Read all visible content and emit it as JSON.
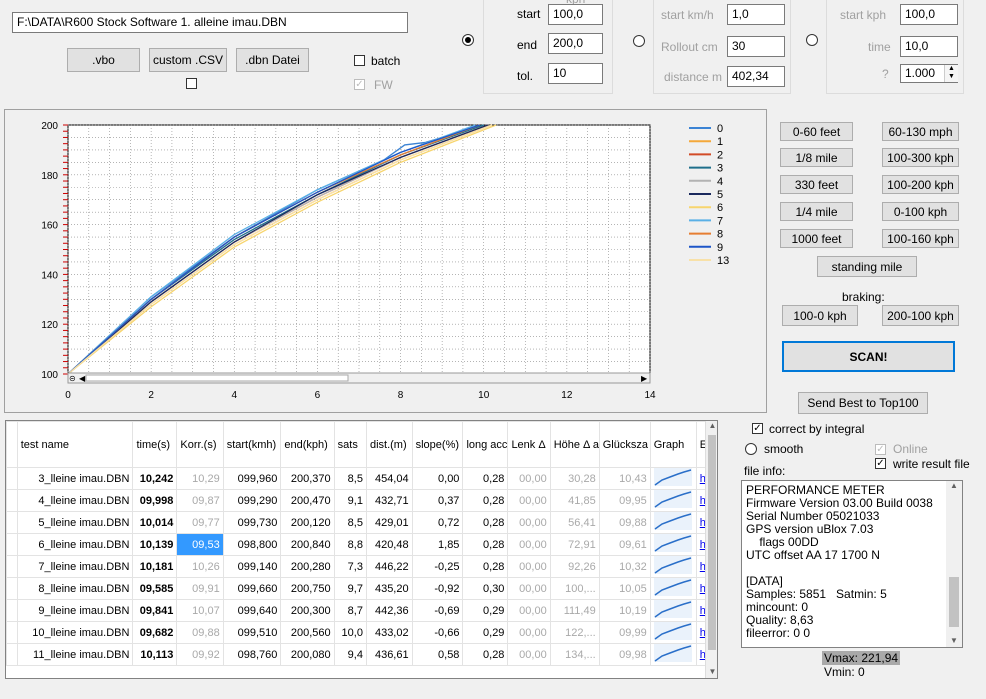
{
  "file_path": "F:\\DATA\\R600 Stock Software 1. alleine imau.DBN",
  "top_buttons": {
    "vbo": ".vbo",
    "csv": "custom .CSV",
    "dbn": ".dbn Datei"
  },
  "options": {
    "batch": "batch",
    "fw": "FW"
  },
  "speed_group": {
    "header": "kph",
    "start_label": "start",
    "start_value": "100,0",
    "end_label": "end",
    "end_value": "200,0",
    "tol_label": "tol.",
    "tol_value": "10"
  },
  "rollout_group": {
    "start_kmh_label": "start km/h",
    "start_kmh_value": "1,0",
    "rollout_label": "Rollout cm",
    "rollout_value": "30",
    "distance_label": "distance m",
    "distance_value": "402,34"
  },
  "kph_group": {
    "start_kph_label": "start kph",
    "start_kph_value": "100,0",
    "time_label": "time",
    "time_value": "10,0",
    "q_label": "?",
    "q_value": "1.000"
  },
  "chart_data": {
    "type": "line",
    "xlim": [
      0,
      14
    ],
    "ylim": [
      100,
      200
    ],
    "x_ticks": [
      "0",
      "2",
      "4",
      "6",
      "8",
      "10",
      "12",
      "14"
    ],
    "y_ticks": [
      "100",
      "120",
      "140",
      "160",
      "180",
      "200"
    ],
    "grid": true,
    "legend_placement": "right",
    "series": [
      {
        "name": "0",
        "color": "#3b83d4",
        "x": [
          0,
          2,
          4,
          6,
          7.6,
          8.1,
          8.6,
          10
        ],
        "y": [
          100,
          131,
          155,
          174,
          186,
          192,
          193,
          200
        ]
      },
      {
        "name": "1",
        "color": "#f4a83a",
        "x": [
          0,
          2,
          4,
          6,
          8,
          10.2
        ],
        "y": [
          100,
          128,
          152,
          170,
          186,
          200
        ]
      },
      {
        "name": "2",
        "color": "#d24b27",
        "x": [
          0,
          2,
          4,
          6,
          8,
          10.1
        ],
        "y": [
          100,
          129,
          153,
          171,
          187,
          200
        ]
      },
      {
        "name": "3",
        "color": "#1f6f8b",
        "x": [
          0,
          2,
          4,
          6,
          8,
          10
        ],
        "y": [
          100,
          130,
          154,
          172,
          188,
          200
        ]
      },
      {
        "name": "4",
        "color": "#b3b3b3",
        "x": [
          0,
          2,
          4,
          6,
          8,
          10.1
        ],
        "y": [
          100,
          129,
          153,
          171,
          187,
          200
        ]
      },
      {
        "name": "5",
        "color": "#1b2a5e",
        "x": [
          0,
          2,
          4,
          6,
          8,
          10.1
        ],
        "y": [
          100,
          129,
          153,
          172,
          187,
          200
        ]
      },
      {
        "name": "6",
        "color": "#f7d56e",
        "x": [
          0,
          2,
          4,
          6,
          8,
          10.3
        ],
        "y": [
          100,
          127,
          151,
          169,
          185,
          200
        ]
      },
      {
        "name": "7",
        "color": "#5ab0e6",
        "x": [
          0,
          2,
          4,
          6,
          8,
          9.8
        ],
        "y": [
          100,
          131,
          156,
          174,
          189,
          200
        ]
      },
      {
        "name": "8",
        "color": "#e67e32",
        "x": [
          0,
          2,
          4,
          6,
          8,
          9.9
        ],
        "y": [
          100,
          130,
          155,
          173,
          188,
          200
        ]
      },
      {
        "name": "9",
        "color": "#1e56c8",
        "x": [
          0,
          2,
          4,
          6,
          8,
          9.9
        ],
        "y": [
          100,
          130,
          155,
          173,
          189,
          200
        ]
      },
      {
        "name": "13",
        "color": "#f8e1a8",
        "x": [
          0,
          2,
          4,
          6,
          8,
          10.2
        ],
        "y": [
          100,
          128,
          152,
          170,
          186,
          200
        ]
      }
    ]
  },
  "preset_buttons": [
    "0-60 feet",
    "60-130 mph",
    "1/8 mile",
    "100-300 kph",
    "330 feet",
    "100-200 kph",
    "1/4 mile",
    "0-100 kph",
    "1000 feet",
    "100-160 kph"
  ],
  "standing_mile": "standing mile",
  "braking_label": "braking:",
  "braking_buttons": [
    "100-0 kph",
    "200-100 kph"
  ],
  "scan_button": "SCAN!",
  "send_best": "Send Best to Top100",
  "correct_integral": "correct by integral",
  "smooth": "smooth",
  "online": "Online",
  "write_result": "write result file",
  "file_info_label": "file info:",
  "file_info_text": "PERFORMANCE METER\nFirmware Version 03.00 Build 0038\nSerial Number 05021033\nGPS version uBlox 7.03\n    flags 00DD\nUTC offset AA 17 1700 N\n\n[DATA]\nSamples: 5851   Satmin: 5\nmincount: 0\nQuality: 8,63\nfileerror: 0 0",
  "vmax": "Vmax: 221,94",
  "vmin": "Vmin: 0",
  "table": {
    "headers": [
      "test name",
      "time(s)",
      "Korr.(s)",
      "start(kmh)",
      "end(kph)",
      "sats",
      "dist.(m)",
      "slope(%)",
      "long acc.(g)",
      "Lenk Δ",
      "Höhe Δ abs",
      "Glücksza",
      "Graph",
      "Ex"
    ],
    "rows": [
      [
        "3_lleine imau.DBN",
        "10,242",
        "10,29",
        "099,960",
        "200,370",
        "8,5",
        "454,04",
        "0,00",
        "0,28",
        "00,00",
        "30,28",
        "10,43",
        "",
        "ht"
      ],
      [
        "4_lleine imau.DBN",
        "09,998",
        "09,87",
        "099,290",
        "200,470",
        "9,1",
        "432,71",
        "0,37",
        "0,28",
        "00,00",
        "41,85",
        "09,95",
        "",
        "ht"
      ],
      [
        "5_lleine imau.DBN",
        "10,014",
        "09,77",
        "099,730",
        "200,120",
        "8,5",
        "429,01",
        "0,72",
        "0,28",
        "00,00",
        "56,41",
        "09,88",
        "",
        "ht"
      ],
      [
        "6_lleine imau.DBN",
        "10,139",
        "09,53",
        "098,800",
        "200,840",
        "8,8",
        "420,48",
        "1,85",
        "0,28",
        "00,00",
        "72,91",
        "09,61",
        "",
        "ht"
      ],
      [
        "7_lleine imau.DBN",
        "10,181",
        "10,26",
        "099,140",
        "200,280",
        "7,3",
        "446,22",
        "-0,25",
        "0,28",
        "00,00",
        "92,26",
        "10,32",
        "",
        "ht"
      ],
      [
        "8_lleine imau.DBN",
        "09,585",
        "09,91",
        "099,660",
        "200,750",
        "9,7",
        "435,20",
        "-0,92",
        "0,30",
        "00,00",
        "100,...",
        "10,05",
        "",
        "ht"
      ],
      [
        "9_lleine imau.DBN",
        "09,841",
        "10,07",
        "099,640",
        "200,300",
        "8,7",
        "442,36",
        "-0,69",
        "0,29",
        "00,00",
        "111,49",
        "10,19",
        "",
        "ht"
      ],
      [
        "10_lleine imau.DBN",
        "09,682",
        "09,88",
        "099,510",
        "200,560",
        "10,0",
        "433,02",
        "-0,66",
        "0,29",
        "00,00",
        "122,...",
        "09,99",
        "",
        "ht"
      ],
      [
        "11_lleine imau.DBN",
        "10,113",
        "09,92",
        "098,760",
        "200,080",
        "9,4",
        "436,61",
        "0,58",
        "0,28",
        "00,00",
        "134,...",
        "09,98",
        "",
        "ht"
      ]
    ]
  }
}
